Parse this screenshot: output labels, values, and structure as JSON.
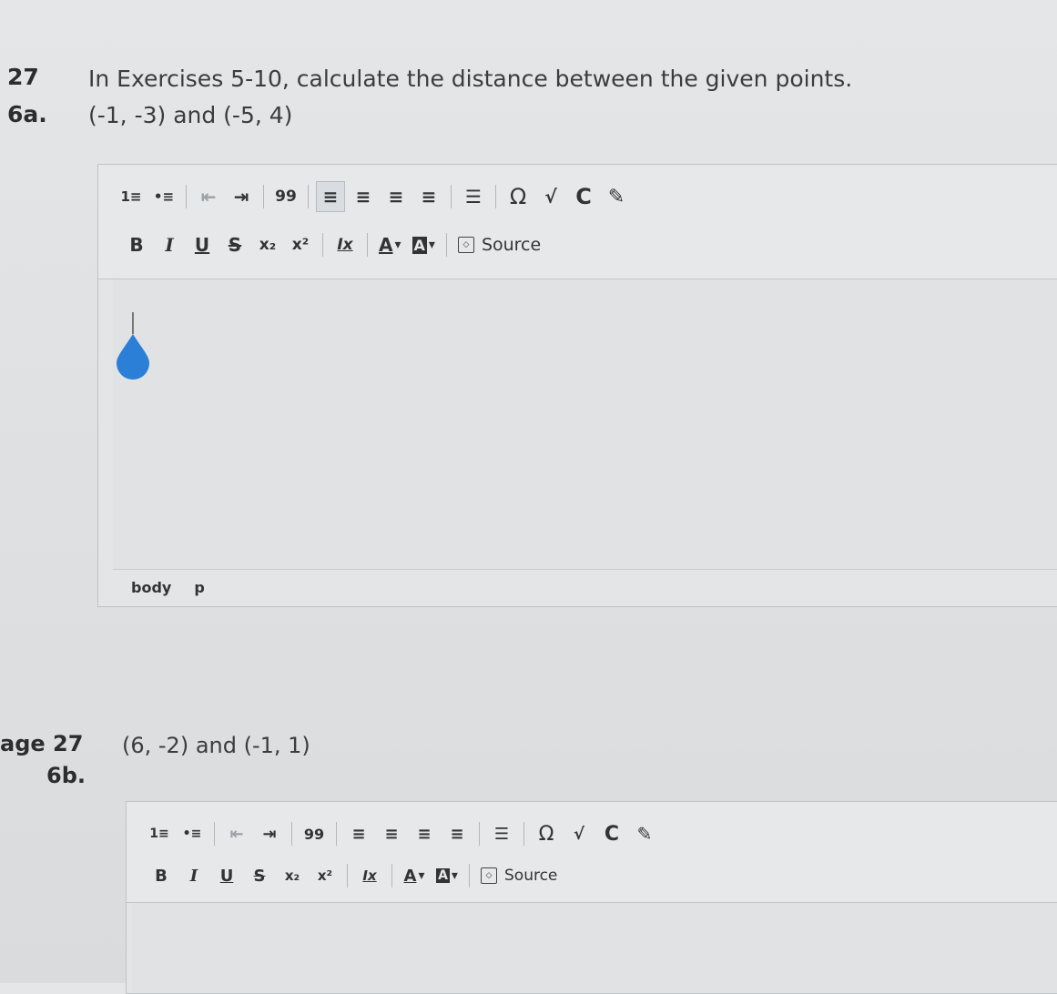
{
  "q1": {
    "page_label": "27",
    "number": "6a.",
    "instruction": "In Exercises 5-10, calculate the distance between the given points.",
    "points": "(-1, -3) and (-5, 4)"
  },
  "q2": {
    "page_label": "age 27",
    "number": "6b.",
    "points": "(6, -2) and (-1, 1)"
  },
  "editor": {
    "source_label": "Source",
    "path_body": "body",
    "path_p": "p",
    "icons": {
      "numbered_list": "1≡",
      "bulleted_list": "•≡",
      "outdent": "⇤",
      "indent": "⇥",
      "blockquote": "99",
      "align_left": "≡",
      "align_center": "≡",
      "align_right": "≡",
      "justify": "≡",
      "hr": "☰",
      "omega": "Ω",
      "sqrt": "√",
      "chem": "C",
      "pencil": "✎",
      "bold": "B",
      "italic": "I",
      "underline": "U",
      "strike": "S",
      "subscript": "x₂",
      "superscript": "x²",
      "remove_format": "Ix",
      "text_color": "A",
      "bg_color": "A"
    }
  },
  "colors": {
    "cursor_drop": "#2b7fd6"
  }
}
